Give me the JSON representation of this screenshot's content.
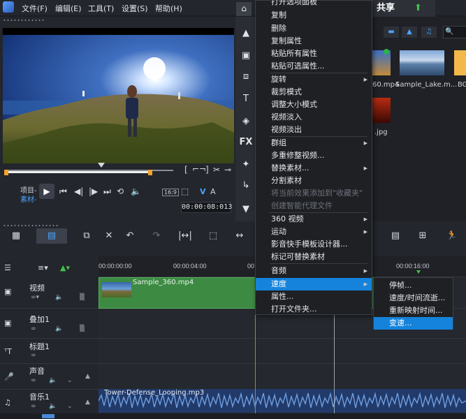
{
  "menubar": {
    "items": [
      "文件(F)",
      "编辑(E)",
      "工具(T)",
      "设置(S)",
      "帮助(H)"
    ],
    "share_tab": "共享"
  },
  "player": {
    "mode_project": "项目-",
    "mode_clip": "素材-",
    "aspect": "16:9",
    "timecode": "00:00:08:013",
    "v_label": "V",
    "a_label": "A"
  },
  "library": {
    "search_placeholder": "",
    "thumbs": [
      {
        "label": "60.mp4"
      },
      {
        "label": "Sample_Lake.m..."
      },
      {
        "label": "BG"
      },
      {
        "label": ".jpg"
      }
    ]
  },
  "timeline": {
    "ruler_ticks": [
      "00:00:00:00",
      "00:00:04:00",
      "00",
      "00:00:16:00"
    ],
    "tracks": [
      {
        "name": "视频"
      },
      {
        "name": "叠加1"
      },
      {
        "name": "标题1"
      },
      {
        "name": "声音"
      },
      {
        "name": "音乐1"
      }
    ],
    "video_clip": "Sample_360.mp4",
    "music_clip": "Tower-Defense_Looping.mp3"
  },
  "context_menu": {
    "items": [
      {
        "label": "打开选项面板",
        "disabled": false,
        "submenu": false
      },
      {
        "label": "复制",
        "disabled": false,
        "submenu": false
      },
      {
        "label": "删除",
        "disabled": false,
        "submenu": false
      },
      {
        "label": "复制属性",
        "disabled": false,
        "submenu": false
      },
      {
        "label": "粘贴所有属性",
        "disabled": false,
        "submenu": false
      },
      {
        "label": "粘贴可选属性...",
        "disabled": false,
        "submenu": false
      },
      {
        "label": "旋转",
        "disabled": false,
        "submenu": true
      },
      {
        "label": "裁剪模式",
        "disabled": false,
        "submenu": false
      },
      {
        "label": "调整大小模式",
        "disabled": false,
        "submenu": false
      },
      {
        "label": "视频淡入",
        "disabled": false,
        "submenu": false
      },
      {
        "label": "视频淡出",
        "disabled": false,
        "submenu": false
      },
      {
        "label": "群组",
        "disabled": false,
        "submenu": true
      },
      {
        "label": "多重修整视频...",
        "disabled": false,
        "submenu": false
      },
      {
        "label": "替换素材...",
        "disabled": false,
        "submenu": true
      },
      {
        "label": "分割素材",
        "disabled": false,
        "submenu": false
      },
      {
        "label": "将当前效果添加到\"收藏夹\"",
        "disabled": true,
        "submenu": false
      },
      {
        "label": "创建智能代理文件",
        "disabled": true,
        "submenu": false
      },
      {
        "label": "360 视频",
        "disabled": false,
        "submenu": true
      },
      {
        "label": "运动",
        "disabled": false,
        "submenu": true
      },
      {
        "label": "影音快手模板设计器...",
        "disabled": false,
        "submenu": false
      },
      {
        "label": "标记可替换素材",
        "disabled": false,
        "submenu": false
      },
      {
        "label": "音频",
        "disabled": false,
        "submenu": true
      },
      {
        "label": "速度",
        "disabled": false,
        "submenu": true
      },
      {
        "label": "属性...",
        "disabled": false,
        "submenu": false
      },
      {
        "label": "打开文件夹...",
        "disabled": false,
        "submenu": false
      }
    ]
  },
  "speed_submenu": {
    "items": [
      "停帧...",
      "速度/时间流逝...",
      "重新映射时间...",
      "变速..."
    ]
  },
  "colors": {
    "accent": "#1583db",
    "clip_green": "#3d8a43",
    "music_blue": "#213a6a",
    "trim_orange": "#f3a32b"
  }
}
